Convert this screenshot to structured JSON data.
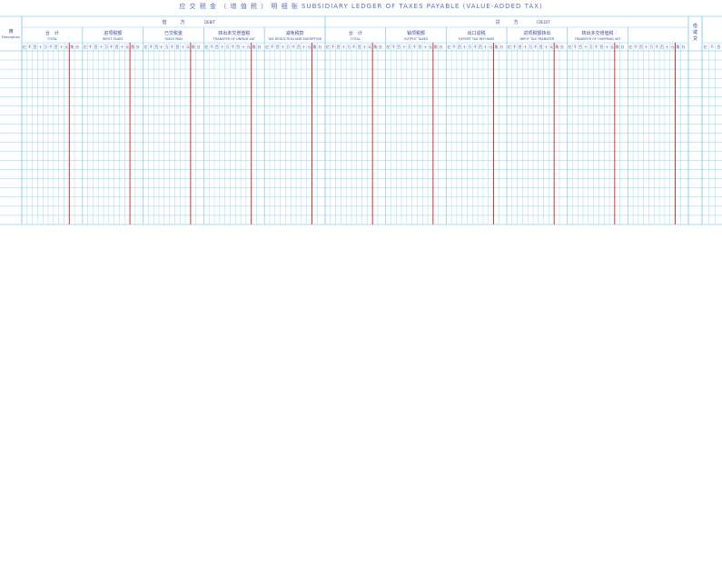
{
  "form": {
    "title": "应 交 税 金 （ 增 值 税 ） 明 细 账  SUBSIDIARY LEDGER OF TAXES PAYABLE (VALUE-ADDED TAX)",
    "description_label_cn": "摘",
    "description_label_en": "Description",
    "debit_label_cn": "借　　　方",
    "debit_label_en": "DEBIT",
    "credit_label_cn": "贷　　　方",
    "credit_label_en": "CREDIT",
    "direction_label": "借或贷",
    "debit_columns": [
      {
        "cn": "合　计",
        "en": "TOTAL"
      },
      {
        "cn": "进项税额",
        "en": "INPUT TAXES"
      },
      {
        "cn": "已交税金",
        "en": "TAXES PAID"
      },
      {
        "cn": "转出未交增值税",
        "en": "TRANSFER OF UNPAID VAT"
      },
      {
        "cn": "减免税款",
        "en": "TAX REDUCTION AND EXEMPTION"
      }
    ],
    "credit_columns": [
      {
        "cn": "合　计",
        "en": "TOTAL"
      },
      {
        "cn": "销项税额",
        "en": "OUTPUT TAXES"
      },
      {
        "cn": "出口退税",
        "en": "EXPORT TAX REFUNDS"
      },
      {
        "cn": "进项税额转出",
        "en": "INPUT TAX TRANSFER"
      },
      {
        "cn": "转出多交增值税",
        "en": "TRANSFER OF OVERPAID VAT"
      },
      {
        "cn": "",
        "en": ""
      }
    ],
    "digit_units": [
      "亿",
      "千",
      "百",
      "十",
      "万",
      "千",
      "百",
      "十",
      "元",
      "角",
      "分"
    ],
    "body_rows": 19
  },
  "colors": {
    "grid_line": "#8fd0ec",
    "decimal_line": "#d0201c",
    "label_text": "#3a4ea8"
  }
}
